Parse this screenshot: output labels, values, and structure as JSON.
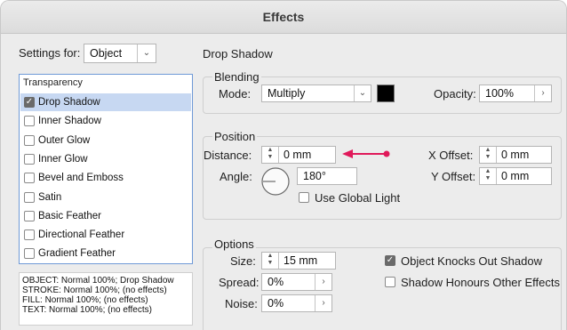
{
  "window": {
    "title": "Effects"
  },
  "settings_for": {
    "label": "Settings for:",
    "value": "Object"
  },
  "effects_list": {
    "header": "Transparency",
    "items": [
      {
        "label": "Drop Shadow",
        "checked": true,
        "selected": true
      },
      {
        "label": "Inner Shadow",
        "checked": false,
        "selected": false
      },
      {
        "label": "Outer Glow",
        "checked": false,
        "selected": false
      },
      {
        "label": "Inner Glow",
        "checked": false,
        "selected": false
      },
      {
        "label": "Bevel and Emboss",
        "checked": false,
        "selected": false
      },
      {
        "label": "Satin",
        "checked": false,
        "selected": false
      },
      {
        "label": "Basic Feather",
        "checked": false,
        "selected": false
      },
      {
        "label": "Directional Feather",
        "checked": false,
        "selected": false
      },
      {
        "label": "Gradient Feather",
        "checked": false,
        "selected": false
      }
    ]
  },
  "summary": [
    "OBJECT: Normal 100%; Drop Shadow",
    "STROKE: Normal 100%; (no effects)",
    "FILL: Normal 100%; (no effects)",
    "TEXT: Normal 100%; (no effects)"
  ],
  "panel": {
    "title": "Drop Shadow"
  },
  "blending": {
    "title": "Blending",
    "mode_label": "Mode:",
    "mode_value": "Multiply",
    "swatch_color": "#000000",
    "opacity_label": "Opacity:",
    "opacity_value": "100%"
  },
  "position": {
    "title": "Position",
    "distance_label": "Distance:",
    "distance_value": "0 mm",
    "angle_label": "Angle:",
    "angle_value": "180°",
    "use_global_light_label": "Use Global Light",
    "use_global_light": false,
    "x_offset_label": "X Offset:",
    "x_offset_value": "0 mm",
    "y_offset_label": "Y Offset:",
    "y_offset_value": "0 mm",
    "annotation_arrow_color": "#e0195a"
  },
  "options": {
    "title": "Options",
    "size_label": "Size:",
    "size_value": "15 mm",
    "spread_label": "Spread:",
    "spread_value": "0%",
    "noise_label": "Noise:",
    "noise_value": "0%",
    "knocks_out_label": "Object Knocks Out Shadow",
    "knocks_out": true,
    "honours_label": "Shadow Honours Other Effects",
    "honours": false
  }
}
